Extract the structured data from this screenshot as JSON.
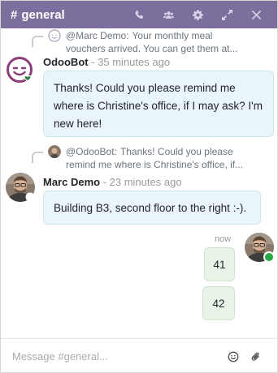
{
  "header": {
    "hash": "#",
    "title": "general",
    "actions": [
      {
        "name": "phone-icon"
      },
      {
        "name": "users-icon"
      },
      {
        "name": "gear-icon"
      },
      {
        "name": "expand-icon"
      },
      {
        "name": "close-icon"
      }
    ],
    "colors": {
      "background": "#7c6f9e"
    }
  },
  "messages": [
    {
      "reply_to": {
        "author": "@Marc Demo:",
        "text": "Your monthly meal vouchers arrived. You can get them at..."
      },
      "author": "OdooBot",
      "time": "- 35 minutes ago",
      "body": "Thanks! Could you please remind me where is Christine's office, if I may ask? I'm new here!"
    },
    {
      "reply_to": {
        "author": "@OdooBot:",
        "text": "Thanks! Could you please remind me where is Christine's office, if..."
      },
      "author": "Marc Demo",
      "time": "- 23 minutes ago",
      "body": "Building B3, second floor to the right :-)."
    }
  ],
  "own_messages": {
    "time": "now",
    "items": [
      "41",
      "42"
    ]
  },
  "composer": {
    "placeholder": "Message #general..."
  }
}
